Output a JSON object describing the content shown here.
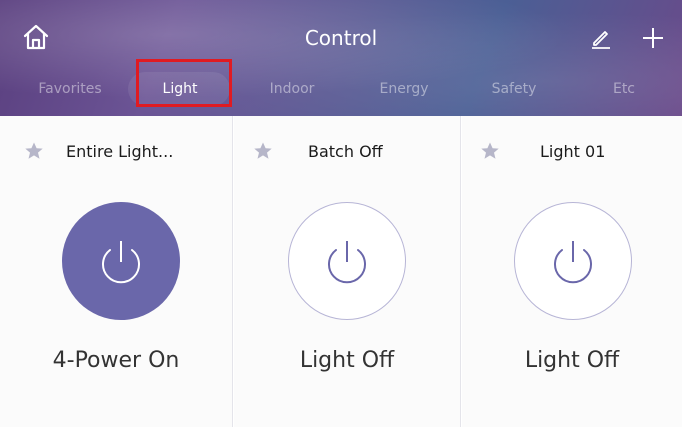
{
  "header": {
    "title": "Control",
    "icons": [
      "home-icon",
      "pencil-icon",
      "plus-icon"
    ]
  },
  "tabs": [
    {
      "label": "Favorites",
      "active": false
    },
    {
      "label": "Light",
      "active": true
    },
    {
      "label": "Indoor",
      "active": false
    },
    {
      "label": "Energy",
      "active": false
    },
    {
      "label": "Safety",
      "active": false
    },
    {
      "label": "Etc",
      "active": false
    }
  ],
  "cards": [
    {
      "name": "Entire Light...",
      "state": "4-Power On",
      "power": "on"
    },
    {
      "name": "Batch Off",
      "state": "Light Off",
      "power": "off"
    },
    {
      "name": "Light 01",
      "state": "Light Off",
      "power": "off"
    }
  ],
  "colors": {
    "accent": "#6a67aa",
    "highlight_box": "#e01b22",
    "star": "#b6b6c9"
  }
}
